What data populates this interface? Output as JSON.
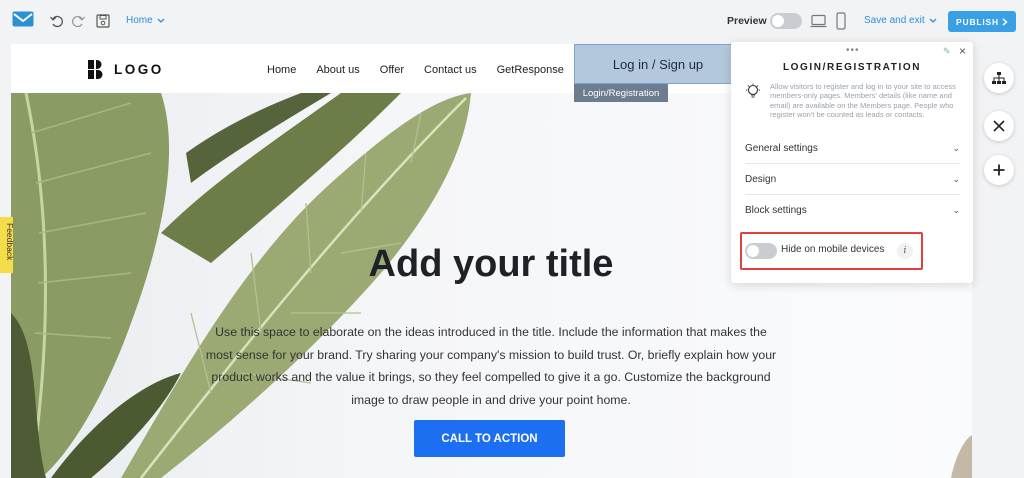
{
  "toolbar": {
    "page_select_value": "Home",
    "preview_label": "Preview",
    "save_exit_label": "Save and exit",
    "publish_label": "PUBLISH"
  },
  "site": {
    "logo_text": "LOGO",
    "nav": [
      "Home",
      "About us",
      "Offer",
      "Contact us",
      "GetResponse"
    ],
    "login_button": "Log in / Sign up",
    "login_tag": "Login/Registration"
  },
  "hero": {
    "title": "Add your title",
    "body": "Use this space to elaborate on the ideas introduced in the title. Include the information that makes the most sense for your brand. Try sharing your company's mission to build trust. Or, briefly explain how your product works and the value it brings, so they feel compelled to give it a go. Customize the background image to draw people in and drive your point home.",
    "cta": "CALL TO ACTION"
  },
  "feedback_label": "Feedback",
  "panel": {
    "title": "LOGIN/REGISTRATION",
    "description": "Allow visitors to register and log in to your site to access members-only pages. Members' details (like name and email) are available on the Members page. People who register won't be counted as leads or contacts.",
    "sections": [
      "General settings",
      "Design",
      "Block settings"
    ],
    "hide_mobile_label": "Hide on mobile devices",
    "hide_mobile_enabled": false
  },
  "colors": {
    "accent": "#3aa0e6",
    "cta": "#1d6ff2",
    "highlight": "#e0403e"
  }
}
